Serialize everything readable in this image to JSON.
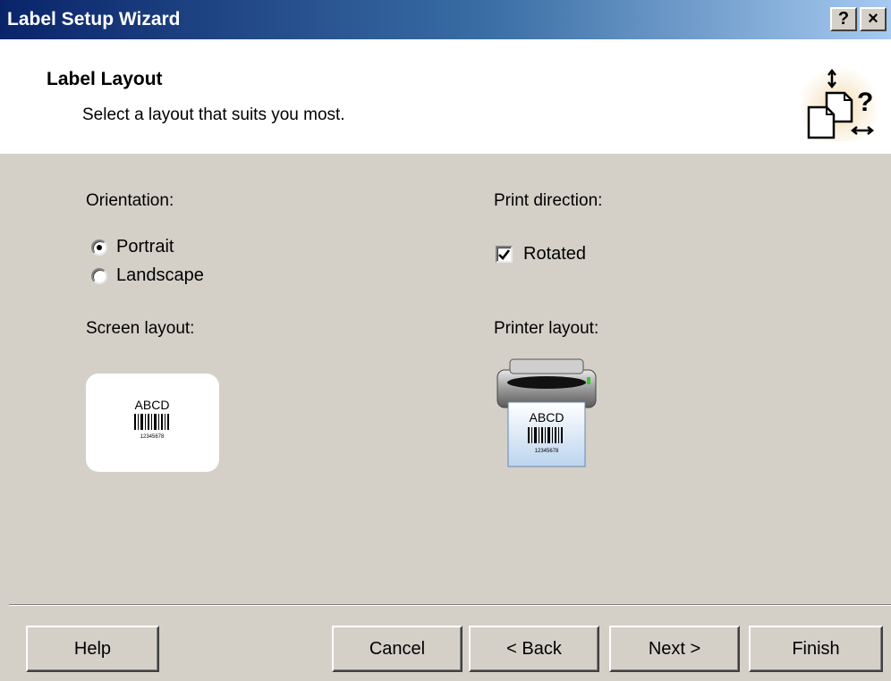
{
  "window": {
    "title": "Label Setup Wizard",
    "help_label": "?",
    "close_label": "×"
  },
  "header": {
    "title": "Label Layout",
    "subtitle": "Select a layout that suits you most.",
    "icon": "layout-help-icon"
  },
  "orientation": {
    "label": "Orientation:",
    "options": [
      {
        "label": "Portrait",
        "selected": true
      },
      {
        "label": "Landscape",
        "selected": false
      }
    ]
  },
  "print_direction": {
    "label": "Print direction:",
    "rotated_label": "Rotated",
    "rotated_checked": true
  },
  "screen_layout": {
    "label": "Screen layout:",
    "preview_text": "ABCD",
    "preview_number": "12345678"
  },
  "printer_layout": {
    "label": "Printer layout:",
    "preview_text": "ABCD",
    "preview_number": "12345678"
  },
  "buttons": {
    "help": "Help",
    "cancel": "Cancel",
    "back": "< Back",
    "next": "Next >",
    "finish": "Finish"
  }
}
